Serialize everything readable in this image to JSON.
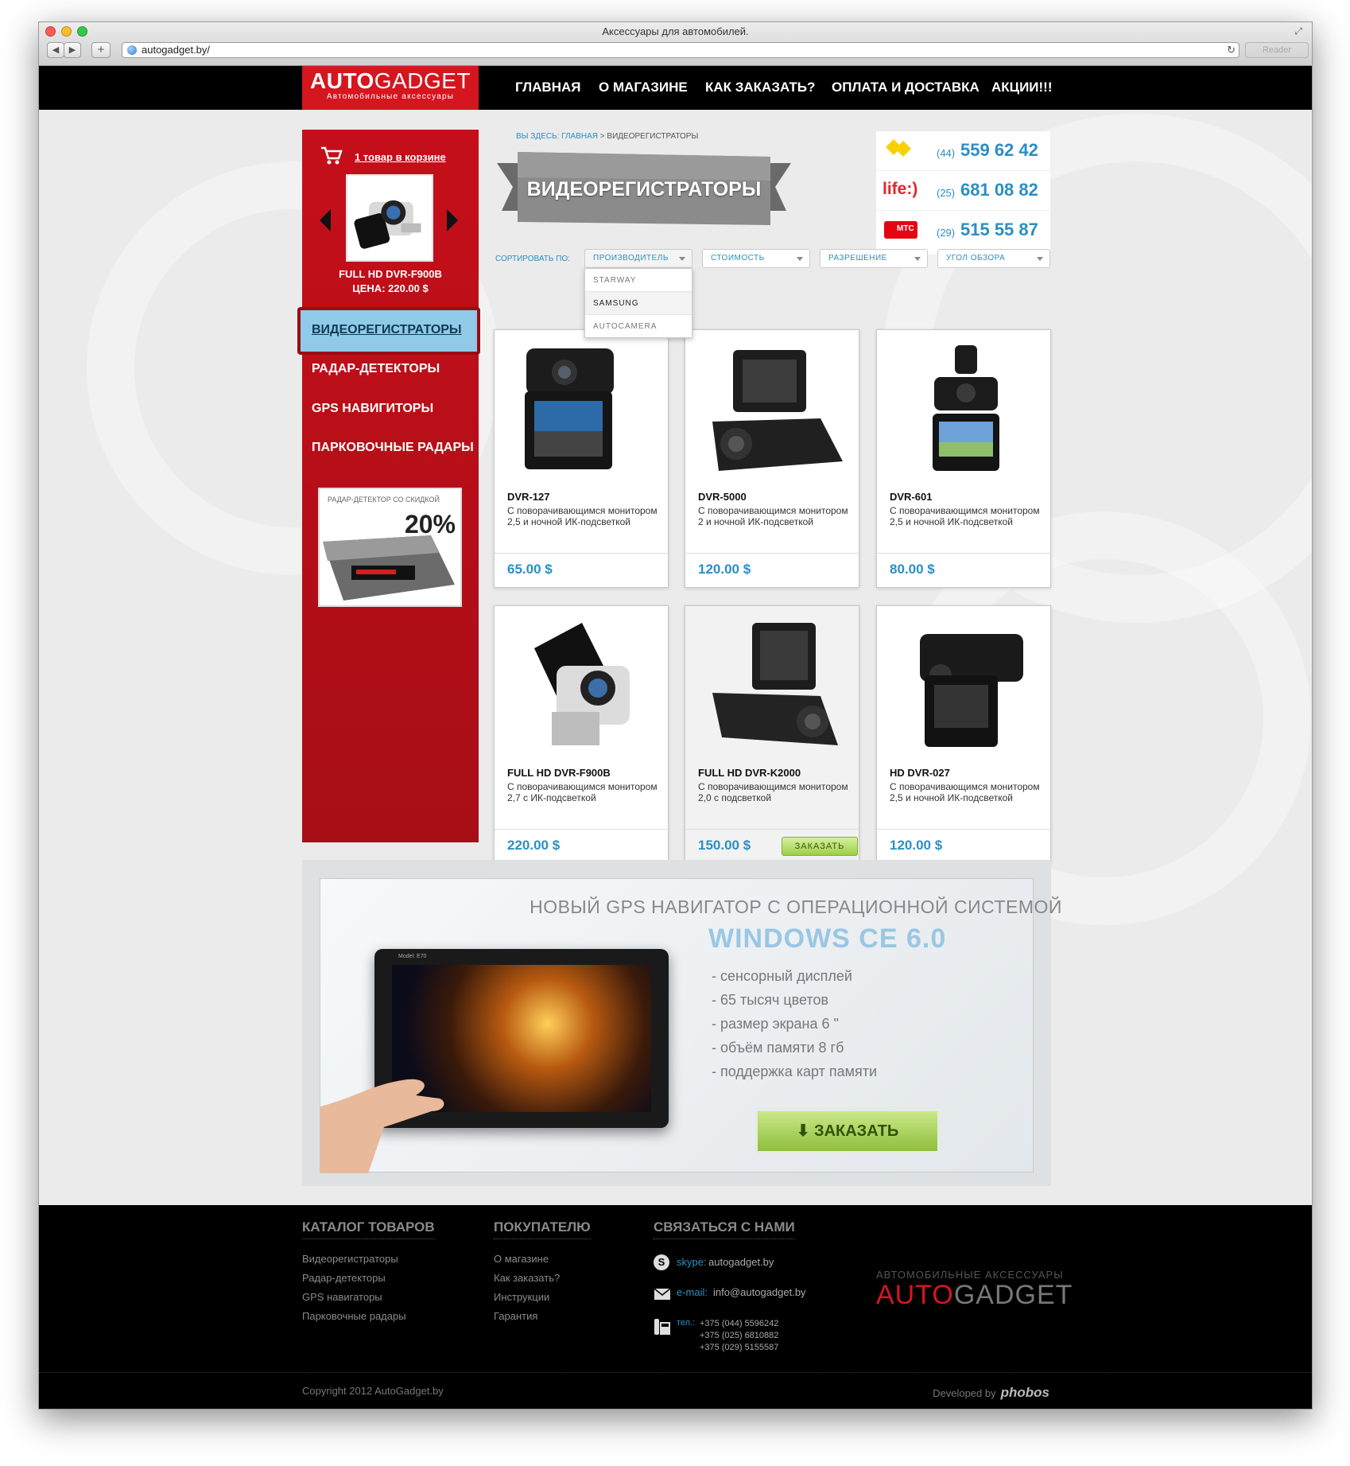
{
  "browser": {
    "window_title": "Аксессуары для автомобилей.",
    "url": "autogadget.by/",
    "reader_label": "Reader",
    "back_glyph": "◀",
    "forward_glyph": "▶",
    "add_glyph": "+",
    "reload_glyph": "↻",
    "resize_glyph": "⤢"
  },
  "header": {
    "logo_bold": "AUTO",
    "logo_rest": "GADGET",
    "logo_sub": "Автомобильные аксессуары",
    "nav": [
      "Главная",
      "О магазине",
      "Как заказать?",
      "Оплата и доставка",
      "Акции!!!"
    ]
  },
  "sidebar": {
    "cart_link": "1 товар в корзине",
    "cart_item_name": "FULL HD DVR-F900B",
    "cart_item_price": "ЦЕНА: 220.00 $",
    "categories": [
      "Видеорегистраторы",
      "Радар-детекторы",
      "GPS навигиторы",
      "Парковочные радары"
    ],
    "promo_text": "Радар-детектор со скидкой",
    "promo_percent": "20%"
  },
  "breadcrumb": {
    "prefix": "Вы здесь:",
    "home": "Главная",
    "separator": ">",
    "current": "Видеорегистраторы"
  },
  "page_title": "Видеорегистраторы",
  "phones": [
    {
      "code": "(44)",
      "number": "559 62 42",
      "operator": "velcom"
    },
    {
      "code": "(25)",
      "number": "681 08 82",
      "operator": "life:)"
    },
    {
      "code": "(29)",
      "number": "515 55 87",
      "operator": "МТС"
    }
  ],
  "sort": {
    "label": "Сортировать по:",
    "filters": [
      "Производитель",
      "Стоимость",
      "Разрешение",
      "Угол обзора"
    ],
    "dropdown_options": [
      "Starway",
      "Samsung",
      "Autocamera"
    ]
  },
  "products": [
    {
      "name": "DVR-127",
      "desc": "С поворачивающимся монитором 2,5 и ночной ИК-подсветкой",
      "price": "65.00 $"
    },
    {
      "name": "DVR-5000",
      "desc": "С поворачивающимся монитором 2 и ночной ИК-подсветкой",
      "price": "120.00 $"
    },
    {
      "name": "DVR-601",
      "desc": "С поворачивающимся монитором 2,5 и ночной ИК-подсветкой",
      "price": "80.00 $"
    },
    {
      "name": "FULL HD DVR-F900B",
      "desc": "С поворачивающимся монитором 2,7 с ИК-подсветкой",
      "price": "220.00 $"
    },
    {
      "name": "FULL HD DVR-K2000",
      "desc": "С поворачивающимся монитором 2,0 с подсветкой",
      "price": "150.00 $"
    },
    {
      "name": "HD DVR-027",
      "desc": "С поворачивающимся монитором 2,5 и ночной ИК-подсветкой",
      "price": "120.00 $"
    }
  ],
  "order_label": "Заказать",
  "banner": {
    "title1": "Новый GPS навигатор с операционной системой",
    "title2": "WINDOWS CE 6.0",
    "features": [
      "- сенсорный дисплей",
      "- 65 тысяч цветов",
      "- размер экрана 6 \"",
      "- объём памяти 8 гб",
      "- поддержка карт памяти"
    ],
    "button": "⬇ ЗАКАЗАТЬ",
    "tablet_model": "Model: E70"
  },
  "footer": {
    "catalog_title": "Каталог товаров",
    "catalog_links": [
      "Видеорегистраторы",
      "Радар-детекторы",
      "GPS навигаторы",
      "Парковочные радары"
    ],
    "buyer_title": "Покупателю",
    "buyer_links": [
      "О магазине",
      "Как заказать?",
      "Инструкции",
      "Гарантия"
    ],
    "contact_title": "Связаться с нами",
    "skype_key": "skype:",
    "skype_value": "autogadget.by",
    "email_key": "e-mail:",
    "email_value": "info@autogadget.by",
    "tel_key": "тел.:",
    "tels": [
      "+375 (044) 5596242",
      "+375 (025) 6810882",
      "+375 (029) 5155587"
    ],
    "logo_sub": "Автомобильные аксессуары",
    "logo_bold": "AUTO",
    "logo_rest": "GADGET",
    "copyright": "Copyright 2012 AutoGadget.by",
    "developed_by": "Developed by",
    "developer": "phobos"
  },
  "colors": {
    "brand_red": "#d5161f",
    "accent_blue": "#2a8fc3",
    "order_green": "#9dce46"
  }
}
